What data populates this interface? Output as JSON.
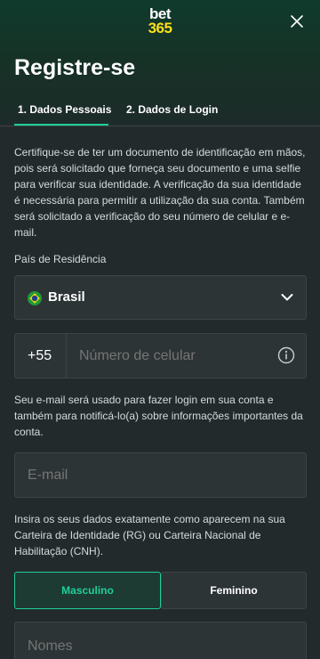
{
  "brand": {
    "line1": "bet",
    "line2": "365"
  },
  "page_title": "Registre-se",
  "tabs": [
    {
      "label": "1. Dados Pessoais",
      "active": true
    },
    {
      "label": "2. Dados de Login",
      "active": false
    }
  ],
  "intro_text": "Certifique-se de ter um documento de identificação em mãos, pois será solicitado que forneça seu documento e uma selfie para verificar sua identidade. A verificação da sua identidade é necessária para permitir a utilização da sua conta. Também será solicitado a verificação do seu número de celular e e-mail.",
  "country": {
    "label": "País de Residência",
    "value": "Brasil",
    "icon": "brazil-flag-icon"
  },
  "phone": {
    "code": "+55",
    "placeholder": "Número de celular"
  },
  "email_note": "Seu e-mail será usado para fazer login em sua conta e também para notificá-lo(a) sobre informações importantes da conta.",
  "email": {
    "placeholder": "E-mail"
  },
  "id_note": "Insira os seus dados exatamente como aparecem na sua Carteira de Identidade (RG) ou Carteira Nacional de Habilitação (CNH).",
  "gender": {
    "options": [
      "Masculino",
      "Feminino"
    ],
    "selected": "Masculino"
  },
  "names": {
    "placeholder": "Nomes"
  },
  "colors": {
    "accent": "#1fcf98",
    "brand_yellow": "#ffdf1b",
    "background": "#232a2c"
  }
}
